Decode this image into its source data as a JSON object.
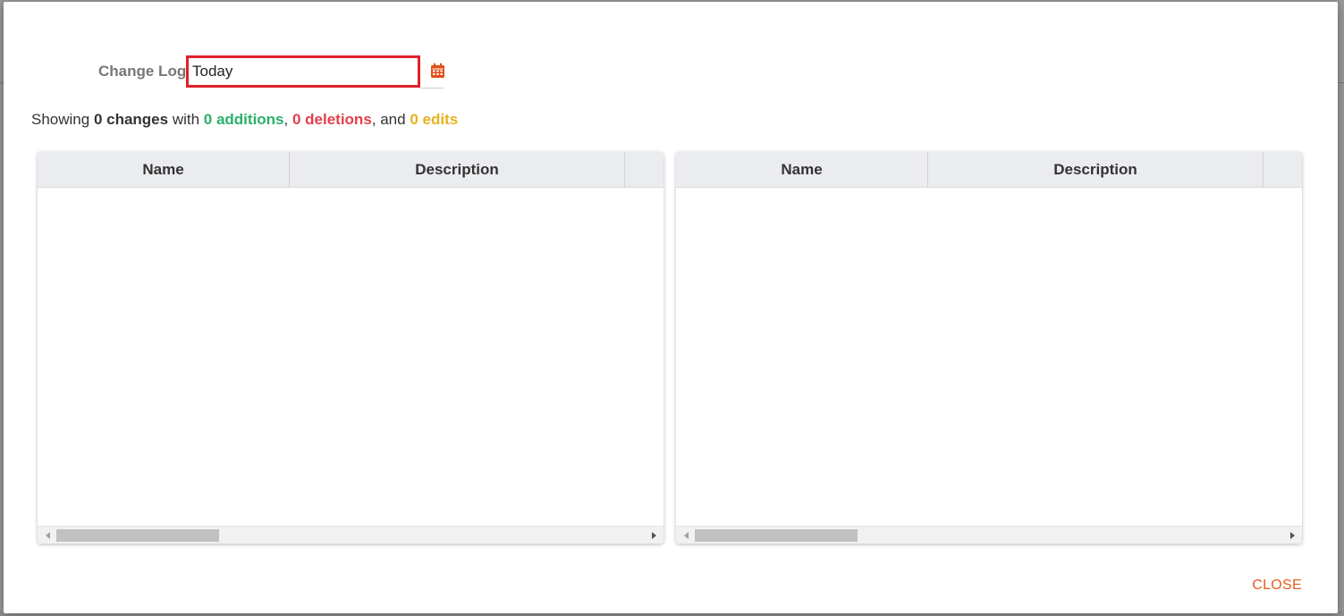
{
  "dialog": {
    "filter": {
      "label": "Change Logs",
      "date_value": "Today"
    },
    "summary": {
      "prefix": "Showing ",
      "changes": "0 changes",
      "with_text": " with ",
      "additions": "0 additions",
      "sep1": ", ",
      "deletions": "0 deletions",
      "and_text": ", and ",
      "edits": "0 edits"
    },
    "left_grid": {
      "columns": [
        "Name",
        "Description",
        ""
      ]
    },
    "right_grid": {
      "columns": [
        "Name",
        "Description",
        ""
      ]
    },
    "close_label": "CLOSE"
  },
  "colors": {
    "additions": "#2ab069",
    "deletions": "#e0404a",
    "edits": "#e8b21e",
    "accent": "#e85a1e",
    "focus_border": "#e0202a"
  },
  "icons": {
    "calendar": "calendar-icon"
  }
}
